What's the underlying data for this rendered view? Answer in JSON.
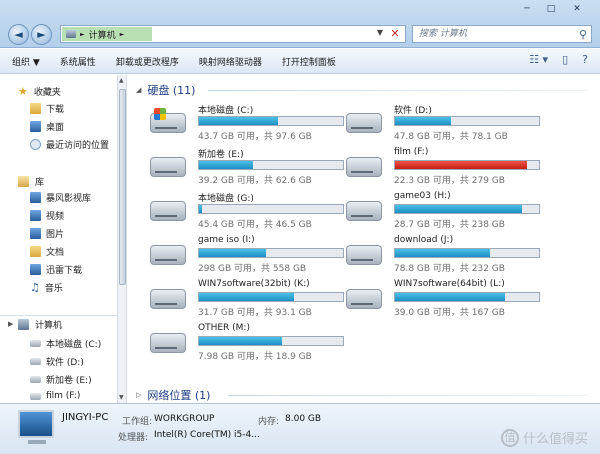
{
  "window": {
    "controls": {
      "minimize": "─",
      "maximize": "□",
      "close": "✕"
    }
  },
  "nav": {
    "back": "◄",
    "forward": "►"
  },
  "address": {
    "crumb": "计算机",
    "crumb_arrow": "►",
    "dropdown": "▼",
    "refresh": "✕"
  },
  "search": {
    "placeholder": "搜索 计算机"
  },
  "toolbar": {
    "items": [
      "组织 ▼",
      "系统属性",
      "卸载或更改程序",
      "映射网络驱动器",
      "打开控制面板"
    ]
  },
  "sidebar": {
    "favorites": {
      "label": "收藏夹",
      "items": [
        "下载",
        "桌面",
        "最近访问的位置"
      ]
    },
    "libraries": {
      "label": "库",
      "items": [
        "暴风影视库",
        "视频",
        "图片",
        "文档",
        "迅雷下载",
        "音乐"
      ]
    },
    "computer": {
      "label": "计算机",
      "items": [
        "本地磁盘 (C:)",
        "软件 (D:)",
        "新加卷 (E:)",
        "film (F:)"
      ]
    }
  },
  "content": {
    "hdd_group": {
      "label": "硬盘 (11)"
    },
    "network_group": {
      "label": "网络位置 (1)"
    },
    "drives": [
      {
        "name": "本地磁盘 (C:)",
        "info": "43.7 GB 可用，共 97.6 GB",
        "used_fraction": 0.552,
        "system": true,
        "full": false
      },
      {
        "name": "软件 (D:)",
        "info": "47.8 GB 可用，共 78.1 GB",
        "used_fraction": 0.388,
        "system": false,
        "full": false
      },
      {
        "name": "新加卷 (E:)",
        "info": "39.2 GB 可用，共 62.6 GB",
        "used_fraction": 0.374,
        "system": false,
        "full": false
      },
      {
        "name": "film (F:)",
        "info": "22.3 GB 可用，共 279 GB",
        "used_fraction": 0.92,
        "system": false,
        "full": true
      },
      {
        "name": "本地磁盘 (G:)",
        "info": "45.4 GB 可用，共 46.5 GB",
        "used_fraction": 0.024,
        "system": false,
        "full": false
      },
      {
        "name": "game03 (H:)",
        "info": "28.7 GB 可用，共 238 GB",
        "used_fraction": 0.879,
        "system": false,
        "full": false
      },
      {
        "name": "game iso (I:)",
        "info": "298 GB 可用，共 558 GB",
        "used_fraction": 0.466,
        "system": false,
        "full": false
      },
      {
        "name": "download (J:)",
        "info": "78.8 GB 可用，共 232 GB",
        "used_fraction": 0.66,
        "system": false,
        "full": false
      },
      {
        "name": "WIN7software(32bit) (K:)",
        "info": "31.7 GB 可用，共 93.1 GB",
        "used_fraction": 0.66,
        "system": false,
        "full": false
      },
      {
        "name": "WIN7software(64bit) (L:)",
        "info": "39.0 GB 可用，共 167 GB",
        "used_fraction": 0.767,
        "system": false,
        "full": false
      },
      {
        "name": "OTHER (M:)",
        "info": "7.98 GB 可用，共 18.9 GB",
        "used_fraction": 0.578,
        "system": false,
        "full": false
      }
    ]
  },
  "details": {
    "pc_name": "JINGYI-PC",
    "workgroup_label": "工作组:",
    "workgroup": "WORKGROUP",
    "memory_label": "内存:",
    "memory": "8.00 GB",
    "cpu_label": "处理器:",
    "cpu": "Intel(R) Core(TM) i5-4..."
  },
  "watermark": {
    "logo": "值",
    "text": "什么值得买"
  }
}
